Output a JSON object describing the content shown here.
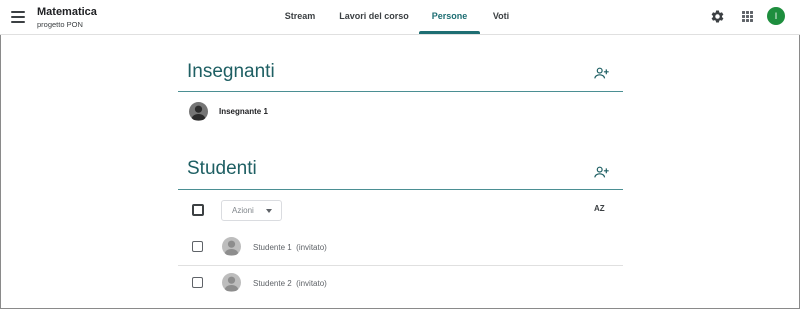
{
  "header": {
    "course_title": "Matematica",
    "course_subtitle": "progetto PON",
    "user_initial": "I",
    "tabs": [
      {
        "label": "Stream"
      },
      {
        "label": "Lavori del corso"
      },
      {
        "label": "Persone",
        "active": true
      },
      {
        "label": "Voti"
      }
    ]
  },
  "teachers": {
    "title": "Insegnanti",
    "list": [
      {
        "name": "Insegnante 1"
      }
    ]
  },
  "students": {
    "title": "Studenti",
    "actions_label": "Azioni",
    "sort_label": "AZ",
    "list": [
      {
        "name": "Studente 1",
        "status": "(invitato)"
      },
      {
        "name": "Studente 2",
        "status": "(invitato)"
      }
    ]
  },
  "colors": {
    "accent": "#1e6e73",
    "avatar_user": "#1e8e3e"
  },
  "icons": [
    "menu-icon",
    "gear-icon",
    "apps-grid-icon",
    "add-person-icon",
    "person-avatar-icon",
    "sort-az-icon",
    "dropdown-caret-icon"
  ]
}
